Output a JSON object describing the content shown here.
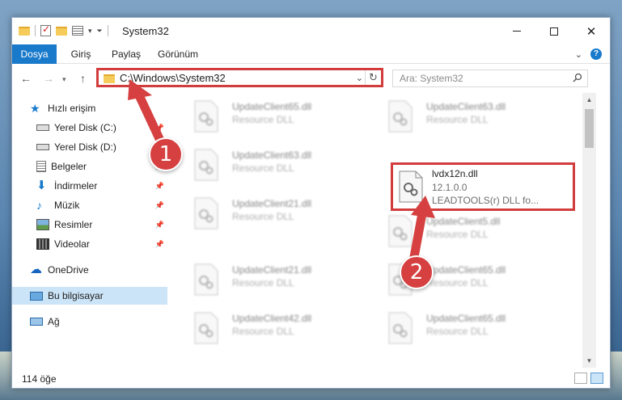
{
  "window": {
    "title": "System32"
  },
  "ribbon": {
    "tabs": [
      "Dosya",
      "Giriş",
      "Paylaş",
      "Görünüm"
    ]
  },
  "address": {
    "path": "C:\\Windows\\System32"
  },
  "search": {
    "placeholder": "Ara: System32"
  },
  "sidebar": {
    "items": [
      {
        "label": "Hızlı erişim",
        "icon": "star-icon"
      },
      {
        "label": "Yerel Disk (C:)",
        "icon": "drive-icon"
      },
      {
        "label": "Yerel Disk (D:)",
        "icon": "drive-icon"
      },
      {
        "label": "Belgeler",
        "icon": "documents-icon"
      },
      {
        "label": "İndirmeler",
        "icon": "download-icon"
      },
      {
        "label": "Müzik",
        "icon": "music-icon"
      },
      {
        "label": "Resimler",
        "icon": "pictures-icon"
      },
      {
        "label": "Videolar",
        "icon": "videos-icon"
      },
      {
        "label": "OneDrive",
        "icon": "cloud-icon"
      },
      {
        "label": "Bu bilgisayar",
        "icon": "computer-icon"
      },
      {
        "label": "Ağ",
        "icon": "network-icon"
      }
    ]
  },
  "files": [
    {
      "name": "UpdateClient65.dll",
      "desc": "Resource DLL"
    },
    {
      "name": "UpdateClient63.dll",
      "desc": "Resource DLL"
    },
    {
      "name": "UpdateClient63.dll",
      "desc": "Resource DLL"
    },
    {
      "name": "lvdx12n.dll",
      "version": "12.1.0.0",
      "desc": "LEADTOOLS(r) DLL fo..."
    },
    {
      "name": "UpdateClient21.dll",
      "desc": "Resource DLL"
    },
    {
      "name": "UpdateClient5.dll",
      "desc": "Resource DLL"
    },
    {
      "name": "UpdateClient21.dll",
      "desc": "Resource DLL"
    },
    {
      "name": "UpdateClient65.dll",
      "desc": "Resource DLL"
    },
    {
      "name": "UpdateClient42.dll",
      "desc": "Resource DLL"
    },
    {
      "name": "UpdateClient65.dll",
      "desc": "Resource DLL"
    }
  ],
  "status": {
    "count": "114 öğe"
  },
  "annotations": {
    "step1": "1",
    "step2": "2",
    "color": "#d64040"
  }
}
